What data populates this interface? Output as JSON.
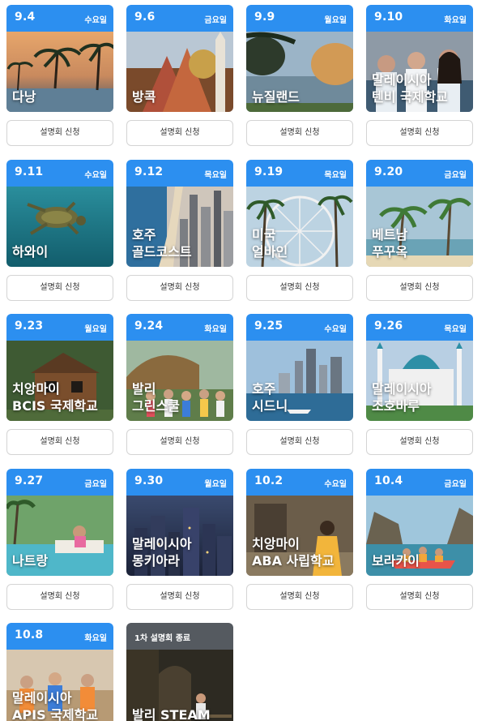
{
  "button_label": "설명회 신청",
  "colors": {
    "accent": "#2c8ff0",
    "ended": "#555a60"
  },
  "cards": [
    {
      "date": "9.4",
      "day": "수요일",
      "location": [
        "다낭"
      ],
      "scene": "beach-resort-palms"
    },
    {
      "date": "9.6",
      "day": "금요일",
      "location": [
        "방콕"
      ],
      "scene": "thai-temple"
    },
    {
      "date": "9.9",
      "day": "월요일",
      "location": [
        "뉴질랜드"
      ],
      "scene": "lake-trees"
    },
    {
      "date": "9.10",
      "day": "화요일",
      "location": [
        "말레이시아",
        "텐비 국제학교"
      ],
      "scene": "students-campus"
    },
    {
      "date": "9.11",
      "day": "수요일",
      "location": [
        "하와이"
      ],
      "scene": "sea-turtle"
    },
    {
      "date": "9.12",
      "day": "목요일",
      "location": [
        "호주",
        "골드코스트"
      ],
      "scene": "coast-skyline"
    },
    {
      "date": "9.19",
      "day": "목요일",
      "location": [
        "미국",
        "얼바인"
      ],
      "scene": "ferris-wheel-palms"
    },
    {
      "date": "9.20",
      "day": "금요일",
      "location": [
        "베트남",
        "푸꾸옥"
      ],
      "scene": "tropical-palms"
    },
    {
      "date": "9.23",
      "day": "월요일",
      "location": [
        "치앙마이",
        "BCIS 국제학교"
      ],
      "scene": "wooden-house"
    },
    {
      "date": "9.24",
      "day": "화요일",
      "location": [
        "발리",
        "그린스쿨"
      ],
      "scene": "bamboo-school"
    },
    {
      "date": "9.25",
      "day": "수요일",
      "location": [
        "호주",
        "시드니"
      ],
      "scene": "harbour-city"
    },
    {
      "date": "9.26",
      "day": "목요일",
      "location": [
        "말레이시아",
        "조호바루"
      ],
      "scene": "mosque"
    },
    {
      "date": "9.27",
      "day": "금요일",
      "location": [
        "나트랑"
      ],
      "scene": "pool-resort"
    },
    {
      "date": "9.30",
      "day": "월요일",
      "location": [
        "말레이시아",
        "몽키아라"
      ],
      "scene": "night-city"
    },
    {
      "date": "10.2",
      "day": "수요일",
      "location": [
        "치앙마이",
        "ABA 사립학교"
      ],
      "scene": "garden-girl"
    },
    {
      "date": "10.4",
      "day": "금요일",
      "location": [
        "보라카이"
      ],
      "scene": "kayak-cliffs"
    },
    {
      "date": "10.8",
      "day": "화요일",
      "location": [
        "말레이시아",
        "APIS 국제학교"
      ],
      "scene": "classroom-kids"
    },
    {
      "date": "",
      "day": "",
      "status": "1차 설명회 종료",
      "location": [
        "발리 STEAM"
      ],
      "scene": "dark-garden"
    }
  ]
}
